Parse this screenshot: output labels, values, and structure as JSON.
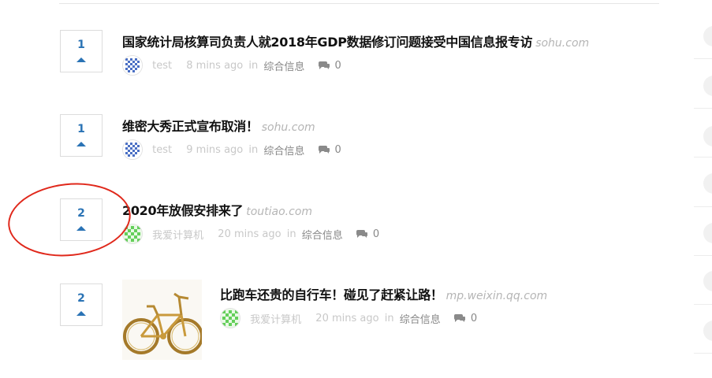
{
  "posts": [
    {
      "votes": "1",
      "title": "国家统计局核算司负责人就2018年GDP数据修订问题接受中国信息报专访",
      "domain": "sohu.com",
      "author": "test",
      "time": "8 mins ago",
      "in": "in",
      "category": "综合信息",
      "comments": "0",
      "avatar": "blue-pattern-avatar",
      "has_thumbnail": false
    },
    {
      "votes": "1",
      "title": "维密大秀正式宣布取消！",
      "domain": "sohu.com",
      "author": "test",
      "time": "9 mins ago",
      "in": "in",
      "category": "综合信息",
      "comments": "0",
      "avatar": "blue-pattern-avatar",
      "has_thumbnail": false
    },
    {
      "votes": "2",
      "title": "2020年放假安排来了",
      "domain": "toutiao.com",
      "author": "我爱计算机",
      "time": "20 mins ago",
      "in": "in",
      "category": "综合信息",
      "comments": "0",
      "avatar": "green-pattern-avatar",
      "has_thumbnail": false
    },
    {
      "votes": "2",
      "title": "比跑车还贵的自行车！碰见了赶紧让路！",
      "domain": "mp.weixin.qq.com",
      "author": "我爱计算机",
      "time": "20 mins ago",
      "in": "in",
      "category": "综合信息",
      "comments": "0",
      "avatar": "green-pattern-avatar",
      "has_thumbnail": true,
      "thumbnail": "gold-bicycle-image"
    }
  ],
  "colors": {
    "accent": "#2a73b5",
    "annotation": "#e0281b",
    "title": "#111111",
    "muted": "#c3c3c3"
  },
  "icons": {
    "upvote": "upvote-arrow-icon",
    "comment": "comment-bubble-icon"
  }
}
